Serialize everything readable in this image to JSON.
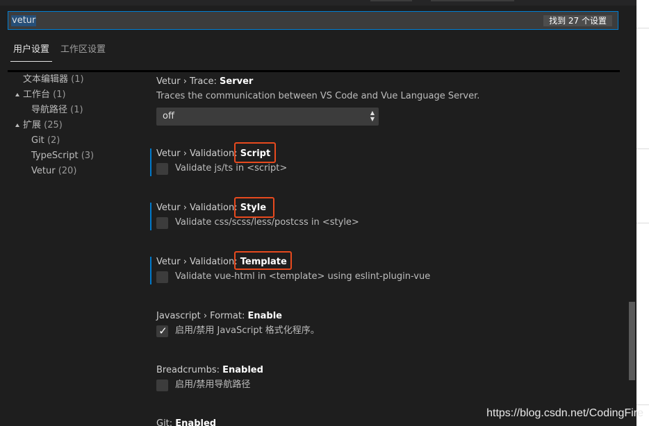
{
  "search": {
    "query": "vetur",
    "result_count": "找到 27 个设置"
  },
  "tabs": [
    {
      "label": "用户设置"
    },
    {
      "label": "工作区设置"
    }
  ],
  "toc": [
    {
      "label": "文本编辑器",
      "count": "(1)"
    },
    {
      "label": "工作台",
      "count": "(1)"
    },
    {
      "label": "导航路径",
      "count": "(1)"
    },
    {
      "label": "扩展",
      "count": "(25)"
    },
    {
      "label": "Git",
      "count": "(2)"
    },
    {
      "label": "TypeScript",
      "count": "(3)"
    },
    {
      "label": "Vetur",
      "count": "(20)"
    }
  ],
  "settings": [
    {
      "prefix": "Vetur › Trace: ",
      "name": "Server",
      "description": "Traces the communication between VS Code and Vue Language Server.",
      "value": "off"
    },
    {
      "prefix": "Vetur › Validation: ",
      "name": "Script",
      "description": "Validate js/ts in <script>",
      "checked": false
    },
    {
      "prefix": "Vetur › Validation: ",
      "name": "Style",
      "description": "Validate css/scss/less/postcss in <style>",
      "checked": false
    },
    {
      "prefix": "Vetur › Validation: ",
      "name": "Template",
      "description": "Validate vue-html in <template> using eslint-plugin-vue",
      "checked": false
    },
    {
      "prefix": "Javascript › Format: ",
      "name": "Enable",
      "description": "启用/禁用 JavaScript 格式化程序。",
      "checked": true,
      "check_glyph": "✓"
    },
    {
      "prefix": "Breadcrumbs: ",
      "name": "Enabled",
      "description": "启用/禁用导航路径",
      "checked": false
    },
    {
      "prefix": "Git: ",
      "name": "Enabled"
    }
  ],
  "watermark": "https://blog.csdn.net/CodingFire",
  "colors": {
    "accent": "#007acc",
    "highlight_box": "#e84a1e",
    "background": "#1e1e1e"
  }
}
